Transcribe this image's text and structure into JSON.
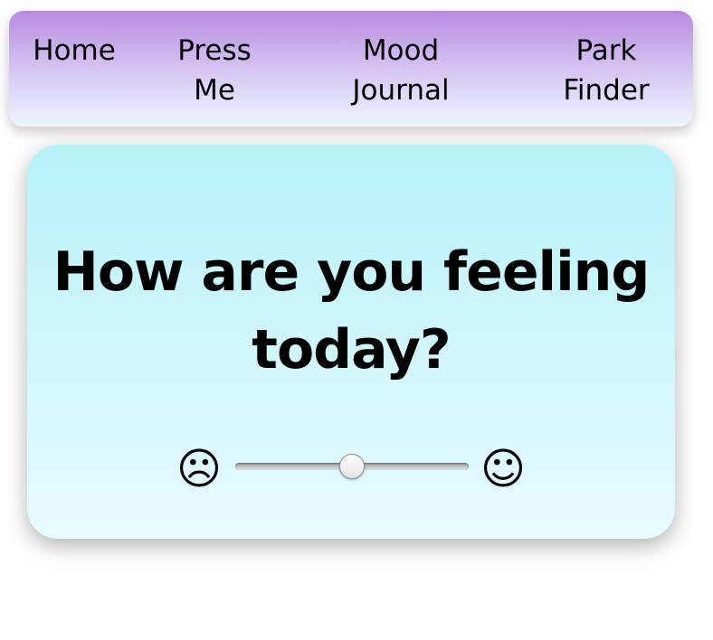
{
  "nav": {
    "items": [
      {
        "label": "Home"
      },
      {
        "label": "Press\nMe"
      },
      {
        "label": "Mood\nJournal"
      },
      {
        "label": "Park\nFinder"
      }
    ]
  },
  "mood": {
    "question": "How are you feeling today?",
    "sad_face": "☹",
    "happy_face": "☺",
    "slider_value": 0.5,
    "slider_min_icon": "sad-face-icon",
    "slider_max_icon": "happy-face-icon"
  },
  "colors": {
    "nav_gradient_top": "#b98ae0",
    "nav_gradient_bottom": "#eef6ff",
    "card_gradient_top": "#b7f2f9",
    "card_gradient_bottom": "#e6fbff"
  }
}
